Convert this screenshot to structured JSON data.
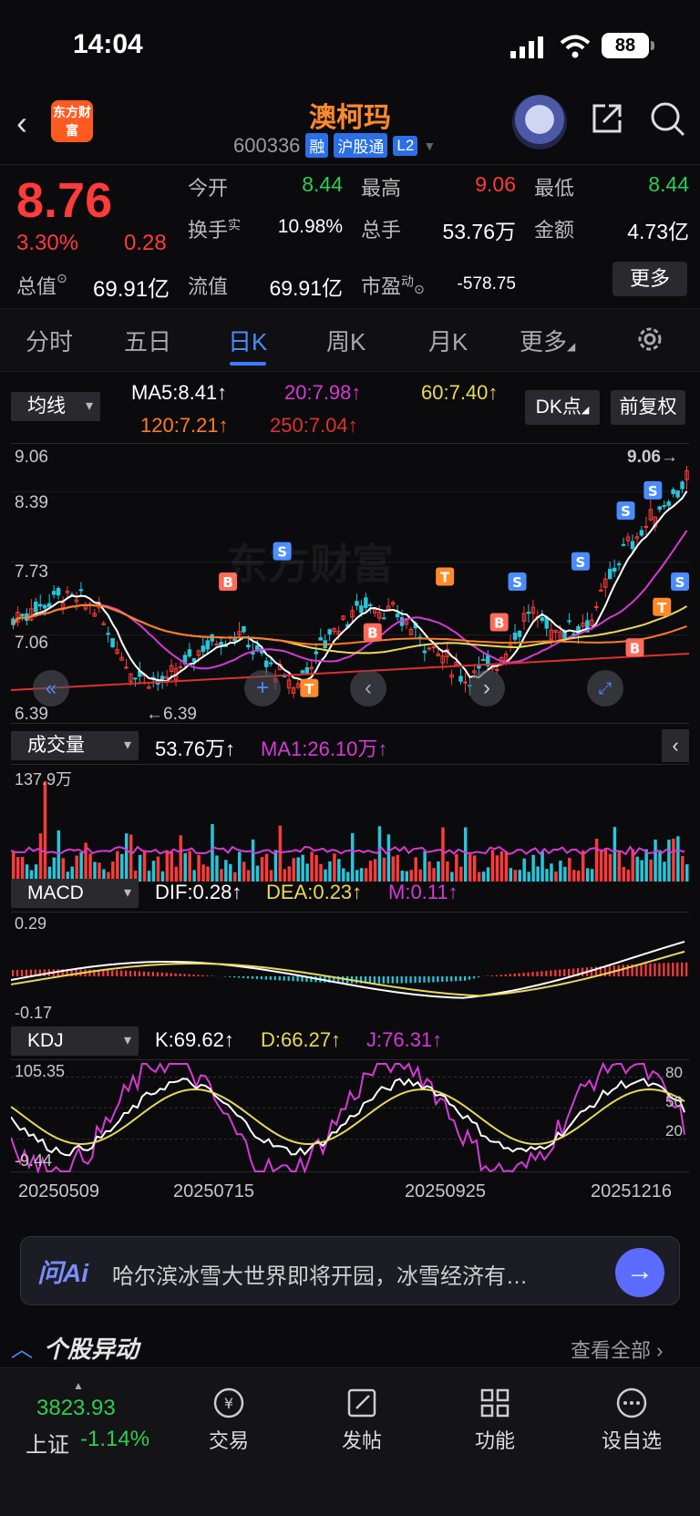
{
  "status": {
    "time": "14:04",
    "battery": "88"
  },
  "header": {
    "logo_text": "东方财富",
    "stock_name": "澳柯玛",
    "stock_code": "600336",
    "tags": [
      "融",
      "沪股通",
      "L2"
    ]
  },
  "quote": {
    "price": "8.76",
    "pct_change": "3.30%",
    "abs_change": "0.28",
    "total_mv_label": "总值",
    "total_mv": "69.91亿",
    "open_label": "今开",
    "open": "8.44",
    "high_label": "最高",
    "high": "9.06",
    "low_label": "最低",
    "low": "8.44",
    "turnover_label": "换手",
    "turnover_sup": "实",
    "turnover": "10.98%",
    "volume_label": "总手",
    "volume": "53.76万",
    "amount_label": "金额",
    "amount": "4.73亿",
    "float_mv_label": "流值",
    "float_mv": "69.91亿",
    "pe_label": "市盈",
    "pe_sup": "动",
    "pe": "-578.75",
    "more": "更多"
  },
  "tabs": {
    "items": [
      "分时",
      "五日",
      "日K",
      "周K",
      "月K",
      "更多"
    ],
    "active": "日K"
  },
  "ma": {
    "dropdown": "均线",
    "ma5": "MA5:8.41↑",
    "ma20": "20:7.98↑",
    "ma60": "60:7.40↑",
    "ma120": "120:7.21↑",
    "ma250": "250:7.04↑",
    "dk_button": "DK点",
    "adjust_button": "前复权"
  },
  "colors": {
    "up": "#ff3b3b",
    "down": "#26c6da",
    "ma5": "#ffffff",
    "ma20": "#d63ad6",
    "ma60": "#e8d95a",
    "ma120": "#ff7a2a",
    "ma250": "#e03030",
    "accent": "#3a7bff"
  },
  "main_chart": {
    "y_top": "9.06",
    "y_2": "8.39",
    "y_3": "7.73",
    "y_4": "7.06",
    "y_bottom": "6.39",
    "high_marker": "9.06",
    "low_marker": "6.39",
    "watermark": "东方财富"
  },
  "volume": {
    "dropdown": "成交量",
    "vol": "53.76万↑",
    "ma1": "MA1:26.10万↑",
    "axis_top": "137.9万"
  },
  "macd": {
    "dropdown": "MACD",
    "dif": "DIF:0.28↑",
    "dea": "DEA:0.23↑",
    "m": "M:0.11↑",
    "axis_top": "0.29",
    "axis_bottom": "-0.17"
  },
  "kdj": {
    "dropdown": "KDJ",
    "k": "K:69.62↑",
    "d": "D:66.27↑",
    "j": "J:76.31↑",
    "axis_top": "105.35",
    "axis_bottom": "-9.44",
    "r80": "80",
    "r50": "50",
    "r20": "20"
  },
  "dates": [
    "20250509",
    "20250715",
    "20250925",
    "20251216"
  ],
  "ai": {
    "logo": "问Ai",
    "headline": "哈尔滨冰雪大世界即将开园，冰雪经济有…"
  },
  "movers": {
    "title": "个股异动",
    "view_all": "查看全部"
  },
  "bottom": {
    "index_value": "3823.93",
    "index_name": "上证",
    "index_pct": "-1.14%",
    "items": [
      "交易",
      "发帖",
      "功能",
      "设自选"
    ]
  }
}
